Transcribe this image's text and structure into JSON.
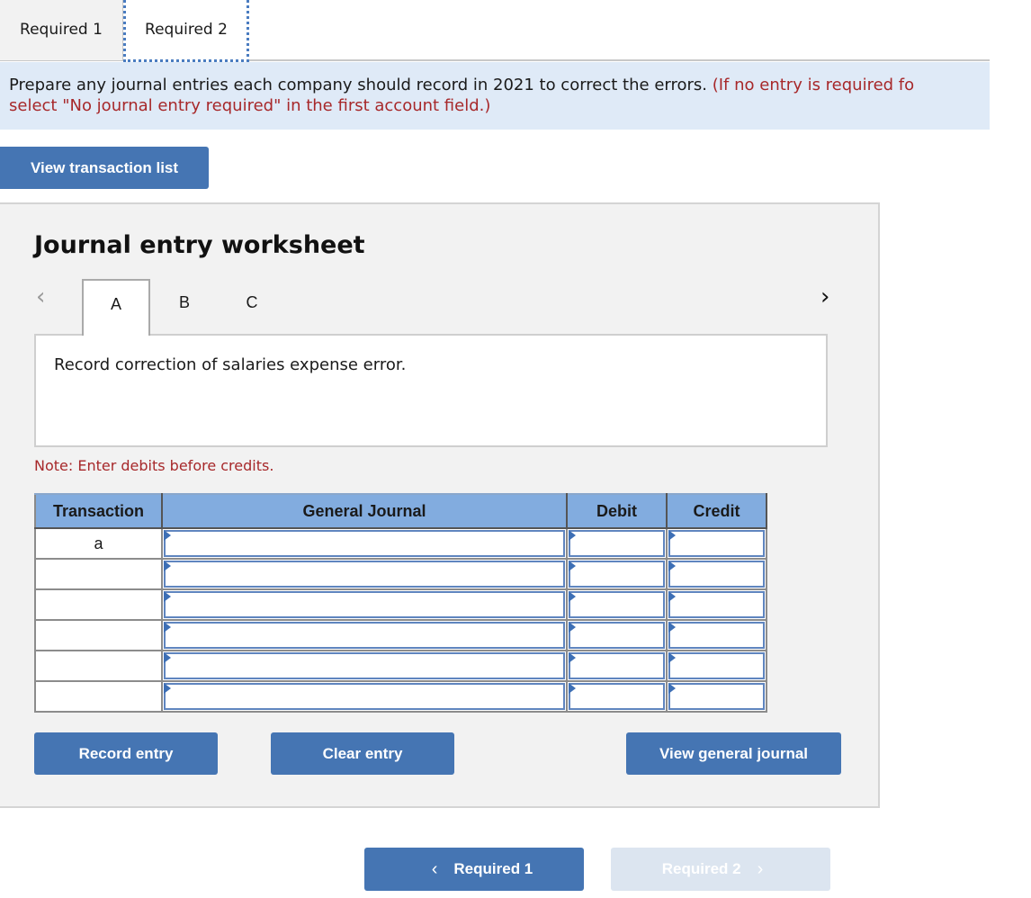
{
  "top_tabs": [
    {
      "label": "Required 1",
      "active": false
    },
    {
      "label": "Required 2",
      "active": true
    }
  ],
  "instructions": {
    "main": "Prepare any journal entries each company should record in 2021 to correct the errors. ",
    "hint_line1": "(If no entry is required fo",
    "hint_line2": "select \"No journal entry required\" in the first account field.)"
  },
  "buttons": {
    "view_transaction_list": "View transaction list",
    "record_entry": "Record entry",
    "clear_entry": "Clear entry",
    "view_general_journal": "View general journal"
  },
  "worksheet": {
    "title": "Journal entry worksheet",
    "prev_icon": "‹",
    "next_icon": "›",
    "tabs": [
      {
        "label": "A",
        "active": true
      },
      {
        "label": "B",
        "active": false
      },
      {
        "label": "C",
        "active": false
      }
    ],
    "description": "Record correction of salaries expense error.",
    "note": "Note: Enter debits before credits."
  },
  "journal_table": {
    "headers": [
      "Transaction",
      "General Journal",
      "Debit",
      "Credit"
    ],
    "rows": [
      {
        "transaction": "a",
        "account": "",
        "debit": "",
        "credit": ""
      },
      {
        "transaction": "",
        "account": "",
        "debit": "",
        "credit": ""
      },
      {
        "transaction": "",
        "account": "",
        "debit": "",
        "credit": ""
      },
      {
        "transaction": "",
        "account": "",
        "debit": "",
        "credit": ""
      },
      {
        "transaction": "",
        "account": "",
        "debit": "",
        "credit": ""
      },
      {
        "transaction": "",
        "account": "",
        "debit": "",
        "credit": ""
      }
    ]
  },
  "bottom_nav": {
    "prev_label": "Required 1",
    "next_label": "Required 2",
    "prev_icon": "‹",
    "next_icon": "›",
    "next_disabled": true
  },
  "colors": {
    "primary_button": "#4575b3",
    "disabled_button": "#dce5f0",
    "banner_bg": "#dfeaf7",
    "hint_red": "#a7282a",
    "table_header": "#82acdf"
  }
}
